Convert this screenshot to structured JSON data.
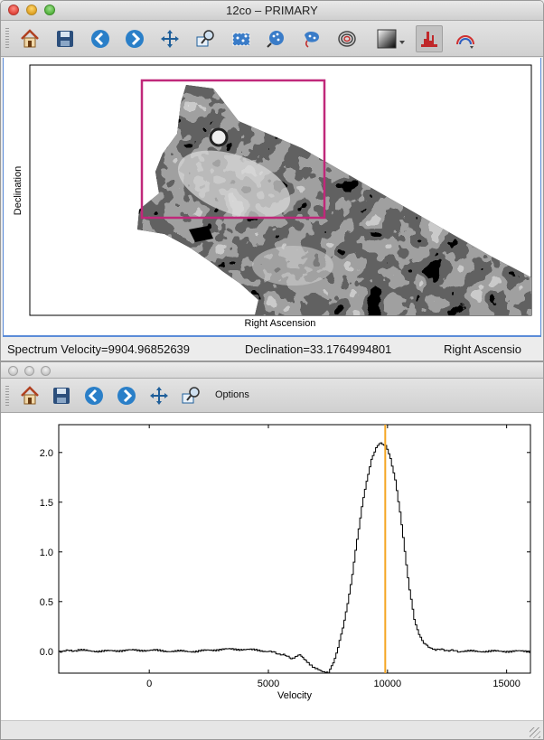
{
  "image_window": {
    "title": "12co – PRIMARY",
    "toolbar": [
      {
        "name": "home-icon"
      },
      {
        "name": "save-icon"
      },
      {
        "name": "back-icon"
      },
      {
        "name": "forward-icon"
      },
      {
        "name": "pan-icon"
      },
      {
        "name": "zoom-to-rect-icon"
      },
      {
        "name": "box-select-icon"
      },
      {
        "name": "lasso-select-icon"
      },
      {
        "name": "paint-select-icon"
      },
      {
        "name": "contour-icon"
      },
      {
        "name": "colormap-icon"
      },
      {
        "name": "histogram-icon"
      },
      {
        "name": "rainbow-icon"
      }
    ],
    "plot": {
      "xlabel": "Right Ascension",
      "ylabel": "Declination"
    },
    "status": {
      "spectrum": "Spectrum Velocity=9904.96852639",
      "declination": "Declination=33.1764994801",
      "ra": "Right Ascensio"
    }
  },
  "spectrum_window": {
    "toolbar": [
      {
        "name": "home-icon"
      },
      {
        "name": "save-icon"
      },
      {
        "name": "back-icon"
      },
      {
        "name": "forward-icon"
      },
      {
        "name": "pan-icon"
      },
      {
        "name": "zoom-to-rect-icon"
      }
    ],
    "options_label": "Options"
  },
  "colors": {
    "roi": "#c0287a",
    "cursor_line": "#f5a623",
    "accent": "#5b8bd8"
  },
  "chart_data": {
    "type": "line",
    "xlabel": "Velocity",
    "ylabel": "",
    "xlim": [
      -3800,
      16000
    ],
    "ylim": [
      -0.22,
      2.28
    ],
    "xticks": [
      0,
      5000,
      10000,
      15000
    ],
    "yticks": [
      0.0,
      0.5,
      1.0,
      1.5,
      2.0
    ],
    "xtick_labels": [
      "0",
      "5000",
      "10000",
      "15000"
    ],
    "ytick_labels": [
      "0.0",
      "0.5",
      "1.0",
      "1.5",
      "2.0"
    ],
    "series": [
      {
        "x": [
          -3800,
          -3000,
          -2000,
          -1000,
          0,
          1000,
          2000,
          3000,
          4000,
          5000,
          5500,
          6000,
          6300,
          6600,
          6900,
          7200,
          7500,
          7700,
          7900,
          8100,
          8300,
          8500,
          8700,
          8900,
          9100,
          9300,
          9500,
          9700,
          9900,
          10100,
          10300,
          10500,
          10700,
          10900,
          11100,
          11300,
          11500,
          11700,
          12000,
          12500,
          13000,
          14000,
          15000,
          16000
        ],
        "y": [
          0.0,
          0.01,
          0.0,
          0.01,
          0.01,
          0.0,
          0.0,
          0.02,
          0.02,
          0.0,
          -0.03,
          -0.07,
          -0.04,
          -0.1,
          -0.17,
          -0.2,
          -0.21,
          -0.12,
          0.03,
          0.24,
          0.48,
          0.78,
          1.12,
          1.45,
          1.72,
          1.93,
          2.05,
          2.09,
          2.07,
          1.95,
          1.72,
          1.4,
          1.0,
          0.62,
          0.33,
          0.16,
          0.08,
          0.04,
          0.02,
          0.01,
          0.0,
          0.0,
          0.0,
          0.0
        ]
      }
    ],
    "cursor_x": 9904.97,
    "grid": false
  }
}
